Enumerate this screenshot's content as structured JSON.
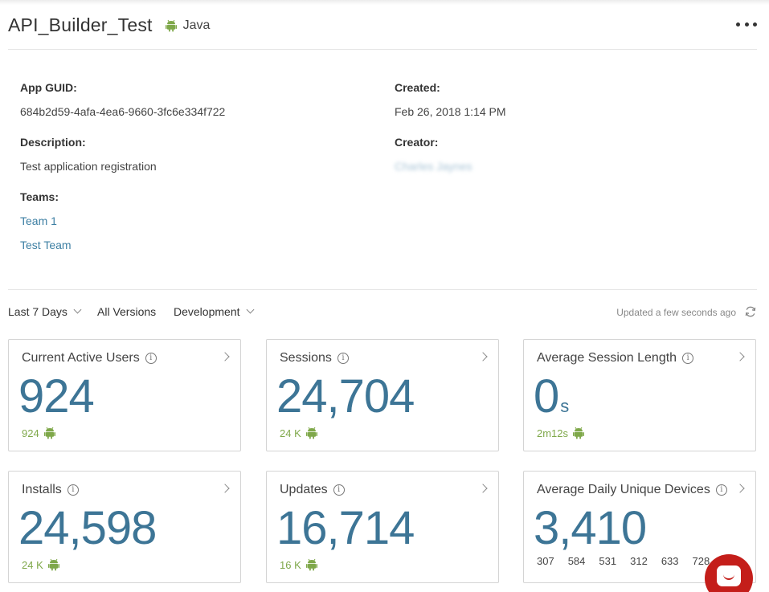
{
  "app": {
    "title": "API_Builder_Test",
    "platform": "Java",
    "platform_icon": "android-icon",
    "more_icon": "more-horizontal-icon"
  },
  "details": {
    "guid_label": "App GUID:",
    "guid_value": "684b2d59-4afa-4ea6-9660-3fc6e334f722",
    "description_label": "Description:",
    "description_value": "Test application registration",
    "teams_label": "Teams:",
    "teams": [
      "Team 1",
      "Test Team"
    ],
    "created_label": "Created:",
    "created_value": "Feb 26, 2018 1:14 PM",
    "creator_label": "Creator:",
    "creator_value": "Charles Jaynes"
  },
  "filters": {
    "range": "Last 7 Days",
    "versions": "All Versions",
    "environment": "Development",
    "updated": "Updated a few seconds ago"
  },
  "cards": [
    {
      "title": "Current Active Users",
      "value": "924",
      "unit": "",
      "sub": "924"
    },
    {
      "title": "Sessions",
      "value": "24,704",
      "unit": "",
      "sub": "24 K"
    },
    {
      "title": "Average Session Length",
      "value": "0",
      "unit": "s",
      "sub": "2m12s"
    },
    {
      "title": "Installs",
      "value": "24,598",
      "unit": "",
      "sub": "24 K"
    },
    {
      "title": "Updates",
      "value": "16,714",
      "unit": "",
      "sub": "16 K"
    },
    {
      "title": "Average Daily Unique Devices",
      "value": "3,410",
      "unit": "",
      "daily": [
        "307",
        "584",
        "531",
        "312",
        "633",
        "728"
      ]
    }
  ],
  "colors": {
    "accent": "#3d7596",
    "link": "#3d7fa3",
    "android": "#7fa84a",
    "chat": "#c41e1a"
  }
}
